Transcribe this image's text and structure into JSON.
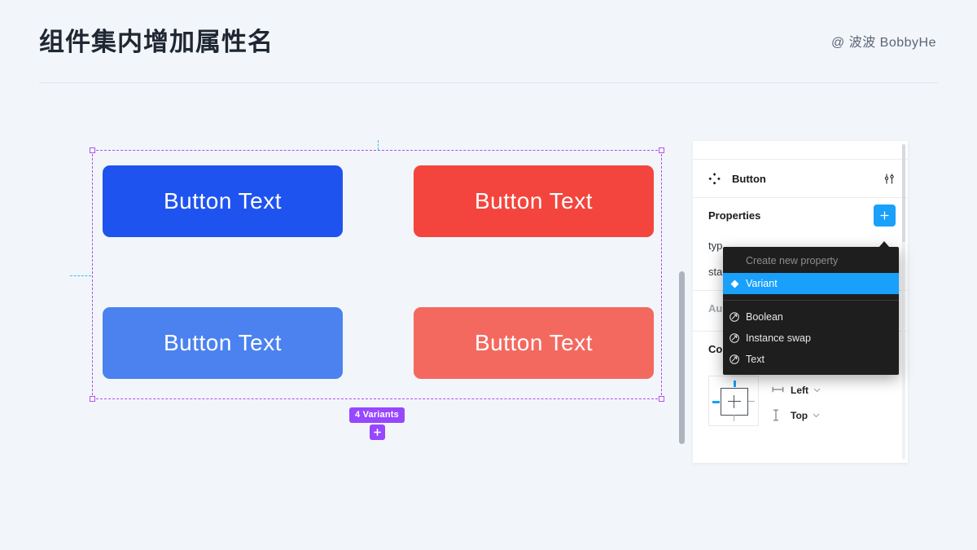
{
  "header": {
    "title": "组件集内增加属性名",
    "credit": "@ 波波 BobbyHe"
  },
  "canvas": {
    "variants_badge": "4 Variants",
    "buttons": [
      {
        "label": "Button Text",
        "color": "#1f53f0"
      },
      {
        "label": "Button Text",
        "color": "#f3453d"
      },
      {
        "label": "Button Text",
        "color": "#4b82f0"
      },
      {
        "label": "Button Text",
        "color": "#f4695f"
      }
    ],
    "selection_color": "#b04df0",
    "guide_color": "#36bdf5"
  },
  "panel": {
    "component": {
      "name": "Button",
      "set_icon": "component-set-icon",
      "tune_icon": "tune-sliders-icon"
    },
    "properties": {
      "title": "Properties",
      "add_label": "+",
      "rows": [
        {
          "label": "typ"
        },
        {
          "label": "sta"
        }
      ]
    },
    "auto_layout": {
      "title": "Au"
    },
    "constraints": {
      "title": "Co",
      "horizontal": {
        "value": "Left",
        "icon": "horizontal-constraint-icon"
      },
      "vertical": {
        "value": "Top",
        "icon": "vertical-constraint-icon"
      },
      "active": [
        "top",
        "left"
      ]
    }
  },
  "context_menu": {
    "header": "Create new property",
    "items": [
      {
        "label": "Variant",
        "icon": "diamond-icon",
        "selected": true
      },
      {
        "label": "Boolean",
        "icon": "property-arrow-icon",
        "selected": false
      },
      {
        "label": "Instance swap",
        "icon": "property-arrow-icon",
        "selected": false
      },
      {
        "label": "Text",
        "icon": "property-arrow-icon",
        "selected": false
      }
    ],
    "accent": "#18a0fb",
    "background": "#1e1e1e"
  }
}
